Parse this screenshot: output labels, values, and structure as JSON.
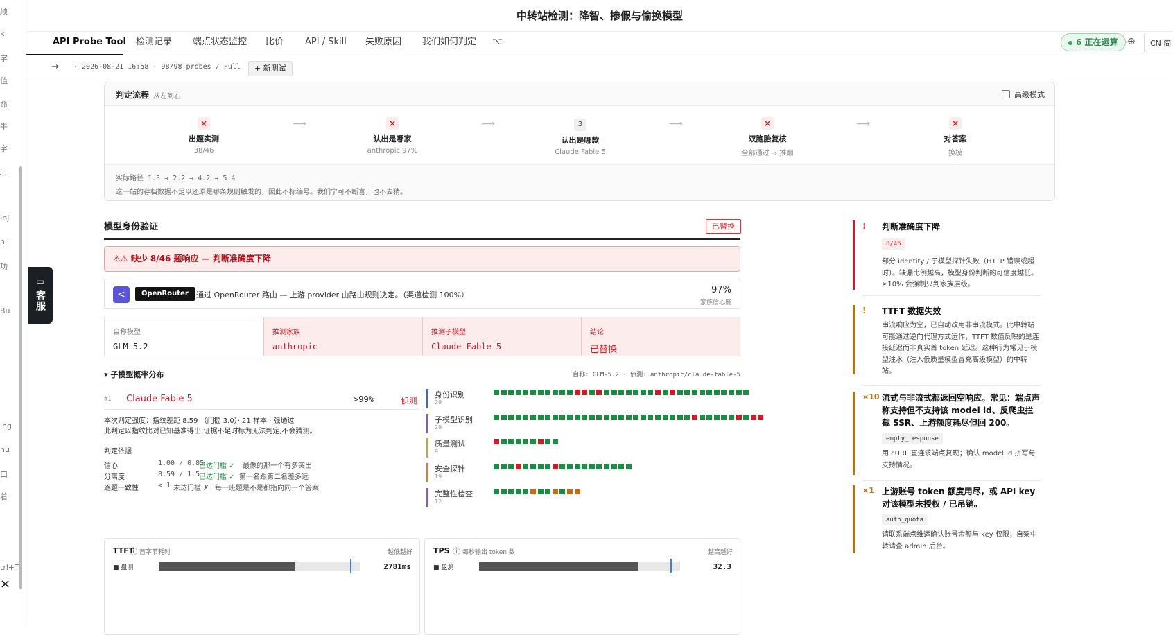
{
  "header": {
    "title": "中转站检测：降智、掺假与偷换模型"
  },
  "nav": {
    "tabs": [
      "API Probe Tool",
      "检测记录",
      "端点状态监控",
      "比价",
      "API / Skill",
      "失败原因",
      "我们如何判定"
    ],
    "running": "6 正在运算",
    "lang": "CN 简"
  },
  "subbar": {
    "meta": "· 2026-08-21 16:58 · 98/98 probes / Full",
    "new_test": "+ 新测试"
  },
  "left_strip": {
    "lines": [
      "顺",
      "k",
      "字",
      "值",
      "命",
      "牛",
      "字",
      "ji_",
      "Inj",
      "nj",
      "功",
      "Bu",
      "ing",
      "nu",
      "口",
      "着"
    ],
    "kefu": "客服",
    "shortcut": "trl+T"
  },
  "flow": {
    "title": "判定流程",
    "hint": "从左到右",
    "advanced": "高级模式",
    "steps": [
      {
        "icon": "×",
        "label": "出题实测",
        "sub": "38/46"
      },
      {
        "icon": "×",
        "label": "认出是哪家",
        "sub": "anthropic 97%"
      },
      {
        "icon": "3",
        "label": "认出是哪款",
        "sub": "Claude Fable 5"
      },
      {
        "icon": "×",
        "label": "双胞胎复核",
        "sub": "全部通过 → 推翻"
      },
      {
        "icon": "×",
        "label": "对答案",
        "sub": "换模"
      }
    ],
    "arrow": "⟶",
    "path": "实际路径 1.3 → 2.2 → 4.2 → 5.4",
    "note": "这一站的存档数据不足以还原是哪条规则触发的，因此不标编号。我们宁可不断言，也不去猜。"
  },
  "identity": {
    "title": "模型身份验证",
    "badge": "已替换",
    "alert": "⚠⚠ 缺少 8/46 题响应 — 判断准确度下降",
    "router_logo": "<",
    "router_badge": "OpenRouter",
    "router_desc": "通过 OpenRouter 路由 — 上游 provider 由路由规则决定。（渠道检测 100%）",
    "router_pct": "97%",
    "router_pct_label": "家族信心度",
    "cells": [
      {
        "k": "自称模型",
        "v": "GLM-5.2"
      },
      {
        "k": "推测家族",
        "v": "anthropic"
      },
      {
        "k": "推测子模型",
        "v": "Claude Fable 5"
      },
      {
        "k": "结论",
        "v": "已替换"
      }
    ]
  },
  "submodel": {
    "title": "▾ 子模型概率分布",
    "right": "自称: GLM-5.2 · 侦测: anthropic/claude-fable-5",
    "rank": {
      "no": "#1",
      "name": "Claude Fable 5",
      "pct": ">99%",
      "tag": "侦测"
    },
    "verdict1": "本次判定强度：指纹差距 8.59 （门槛 3.0）· 21 样本 · 强通过",
    "verdict2": "此判定以指纹比对已知基准得出;证据不足时标为无法判定,不会猜测。",
    "basis_title": "判定依据",
    "basis": [
      {
        "k": "信心",
        "v": "1.00 / 0.85",
        "s": "已达门槛 ✓",
        "d": "最像的那一个有多突出"
      },
      {
        "k": "分离度",
        "v": "8.59 / 1.5",
        "s": "已达门槛 ✓",
        "d": "第一名跟第二名差多远"
      },
      {
        "k": "逐题一致性",
        "v": "< 1",
        "s": "未达门槛 ✗",
        "d": "每一班题是不是都指向同一个答案"
      }
    ]
  },
  "probes": [
    {
      "name": "身份识别",
      "count": "29",
      "color": "#2f6fd6",
      "cells": "gggggggggggrrgrgggggggrgrgggggggggg"
    },
    {
      "name": "子模型识别",
      "count": "29",
      "color": "#8a4fd6",
      "cells": "gggggggggggggggggggggggggggrgggggrgrr"
    },
    {
      "name": "质量测试",
      "count": "9",
      "color": "#d9a020",
      "cells": "rgggggrgg"
    },
    {
      "name": "安全探针",
      "count": "19",
      "color": "#e07a20",
      "cells": "gggrggggrgggggggggg"
    },
    {
      "name": "完整性检查",
      "count": "12",
      "color": "#9a4fd6",
      "cells": "gggggoggogoo"
    }
  ],
  "metrics": [
    {
      "title": "TTFT",
      "icon": "ⓘ",
      "sub": "首字节耗时",
      "right": "越低越好",
      "legend": "■ 盘测",
      "value": "2781ms",
      "fill": 0.68,
      "mark": 0.95
    },
    {
      "title": "TPS",
      "icon": "ⓘ",
      "sub": "每秒输出 token 数",
      "right": "越高越好",
      "legend": "■ 盘测",
      "value": "32.3",
      "fill": 0.79,
      "mark": 0.95
    }
  ],
  "issues": [
    {
      "mark": "!",
      "title": "判断准确度下降",
      "code": "8/46",
      "desc": "部分 identity / 子模型探针失败（HTTP 错误或超时）。缺漏比例越高，模型身份判断的可信度越低。≥10% 会强制只判家族层级。",
      "color": "#c8202a"
    },
    {
      "mark": "!",
      "title": "TTFT 数据失效",
      "code": "",
      "desc": "串流响应为空，已自动改用非串流模式。此中转站可能通过逆向代理方式运作，TTFT 数值反映的是连接延迟而非真实首 token 延迟。这种行为常见于模型注水（注入低质量模型冒充高级模型）的中转站。",
      "color": "#b8711a"
    },
    {
      "mark": "×10",
      "title": "流式与非流式都返回空响应。常见：端点声称支持但不支持该 model id、反爬虫拦截 SSR、上游额度耗尽但回 200。",
      "code": "empty_response",
      "desc": "用 cURL 直连该端点复现；确认 model id 拼写与支持情况。",
      "color": "#b8711a"
    },
    {
      "mark": "×1",
      "title": "上游账号 token 额度用尽，或 API key 对该模型未授权 / 已吊销。",
      "code": "auth_quota",
      "desc": "请联系端点维运确认账号余额与 key 权限；自架中转请查 admin 后台。",
      "color": "#b8711a"
    }
  ]
}
